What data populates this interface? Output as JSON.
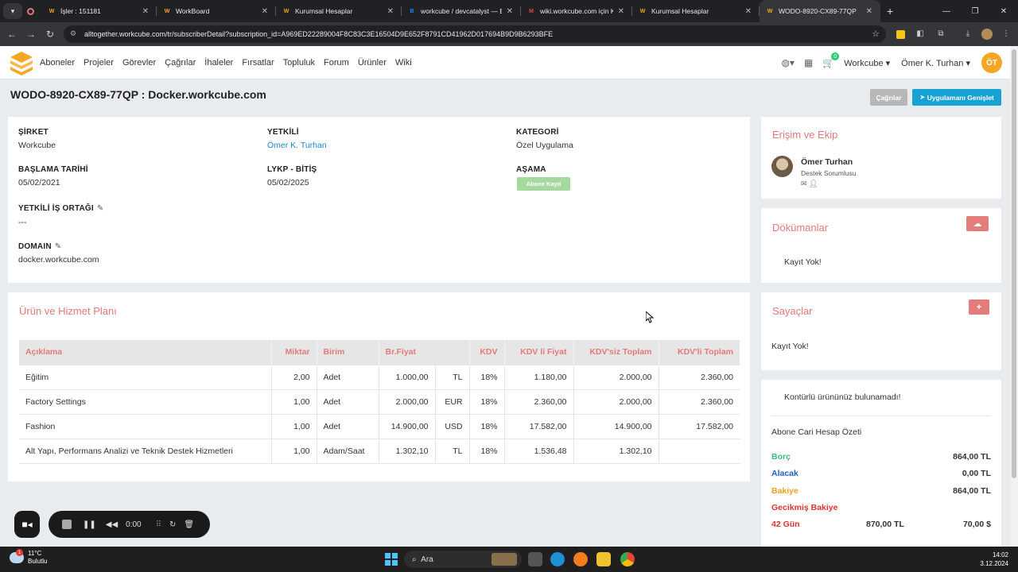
{
  "browser": {
    "tabs": [
      {
        "title": "İşler : 151181",
        "fav": "W",
        "fav_color": "#f5a623",
        "active": false
      },
      {
        "title": "WorkBoard",
        "fav": "W",
        "fav_color": "#f5a623",
        "active": false
      },
      {
        "title": "Kurumsal Hesaplar",
        "fav": "W",
        "fav_color": "#f5a623",
        "active": false
      },
      {
        "title": "workcube / devcatalyst — Bitbucket",
        "fav": "B",
        "fav_color": "#2684ff",
        "active": false
      },
      {
        "title": "wiki.workcube.com için Kasım",
        "fav": "M",
        "fav_color": "#ea4335",
        "active": false
      },
      {
        "title": "Kurumsal Hesaplar",
        "fav": "W",
        "fav_color": "#f5a623",
        "active": false
      },
      {
        "title": "WODO-8920-CX89-77QP",
        "fav": "W",
        "fav_color": "#f5a623",
        "active": true
      }
    ],
    "url": "alltogether.workcube.com/tr/subscriberDetail?subscription_id=A969ED22289004F8C83C3E16504D9E652F8791CD41962D017694B9D9B6293BFE"
  },
  "nav": {
    "menu": [
      "Aboneler",
      "Projeler",
      "Görevler",
      "Çağrılar",
      "İhaleler",
      "Fırsatlar",
      "Topluluk",
      "Forum",
      "Ürünler",
      "Wiki"
    ],
    "cart_count": "0",
    "company": "Workcube",
    "user": "Ömer K. Turhan",
    "avatar_initials": "ÖT"
  },
  "page": {
    "title": "WODO-8920-CX89-77QP : Docker.workcube.com",
    "calls_button": "Çağrılar",
    "extend_button": "Uygulamanı Genişlet"
  },
  "details": {
    "company_label": "ŞİRKET",
    "company": "Workcube",
    "authorized_label": "YETKİLİ",
    "authorized": "Ömer K. Turhan",
    "category_label": "KATEGORİ",
    "category": "Özel Uygulama",
    "start_label": "BAŞLAMA TARİHİ",
    "start": "05/02/2021",
    "lykp_label": "LYKP - BİTİŞ",
    "lykp": "05/02/2025",
    "stage_label": "AŞAMA",
    "stage": "Abone Kayıt",
    "partner_label": "YETKİLİ İŞ ORTAĞI",
    "partner": "---",
    "domain_label": "DOMAIN",
    "domain": "docker.workcube.com"
  },
  "plan": {
    "title": "Ürün ve Hizmet Planı",
    "columns": [
      "Açıklama",
      "Miktar",
      "Birim",
      "Br.Fiyat",
      "KDV",
      "KDV li Fiyat",
      "KDV'siz Toplam",
      "KDV'li Toplam"
    ],
    "rows": [
      {
        "desc": "Eğitim",
        "qty": "2,00",
        "unit": "Adet",
        "price": "1.000,00",
        "cur": "TL",
        "vat": "18%",
        "vat_price": "1.180,00",
        "net_total": "2.000,00",
        "gross_total": "2.360,00"
      },
      {
        "desc": "Factory Settings",
        "qty": "1,00",
        "unit": "Adet",
        "price": "2.000,00",
        "cur": "EUR",
        "vat": "18%",
        "vat_price": "2.360,00",
        "net_total": "2.000,00",
        "gross_total": "2.360,00"
      },
      {
        "desc": "Fashion",
        "qty": "1,00",
        "unit": "Adet",
        "price": "14.900,00",
        "cur": "USD",
        "vat": "18%",
        "vat_price": "17.582,00",
        "net_total": "14.900,00",
        "gross_total": "17.582,00"
      },
      {
        "desc": "Alt Yapı, Performans Analizi ve Teknik Destek Hizmetleri",
        "qty": "1,00",
        "unit": "Adam/Saat",
        "price": "1.302,10",
        "cur": "TL",
        "vat": "18%",
        "vat_price": "1.536,48",
        "net_total": "1.302,10",
        "gross_total": ""
      }
    ]
  },
  "access": {
    "title": "Erişim ve Ekip",
    "person_name": "Ömer Turhan",
    "person_role": "Destek Sorumlusu"
  },
  "documents": {
    "title": "Dökümanlar",
    "empty": "Kayıt Yok!"
  },
  "counters": {
    "title": "Sayaçlar",
    "empty": "Kayıt Yok!"
  },
  "summary": {
    "no_credit": "Kontürlü ürününüz bulunamadı!",
    "account_title": "Abone Cari Hesap Özeti",
    "debt_label": "Borç",
    "debt": "864,00 TL",
    "credit_label": "Alacak",
    "credit": "0,00 TL",
    "balance_label": "Bakiye",
    "balance": "864,00 TL",
    "overdue_label": "Gecikmiş Bakiye",
    "days": "42 Gün",
    "overdue_tl": "870,00 TL",
    "overdue_usd": "70,00 $",
    "colors": {
      "debt": "#3cb878",
      "credit": "#1e5fc0",
      "balance": "#f0a020",
      "overdue": "#e03030"
    }
  },
  "recorder": {
    "time": "0:00"
  },
  "taskbar": {
    "temp": "11°C",
    "weather": "Bulutlu",
    "weather_badge": "1",
    "search": "Ara",
    "time": "14:02",
    "date": "3.12.2024"
  }
}
